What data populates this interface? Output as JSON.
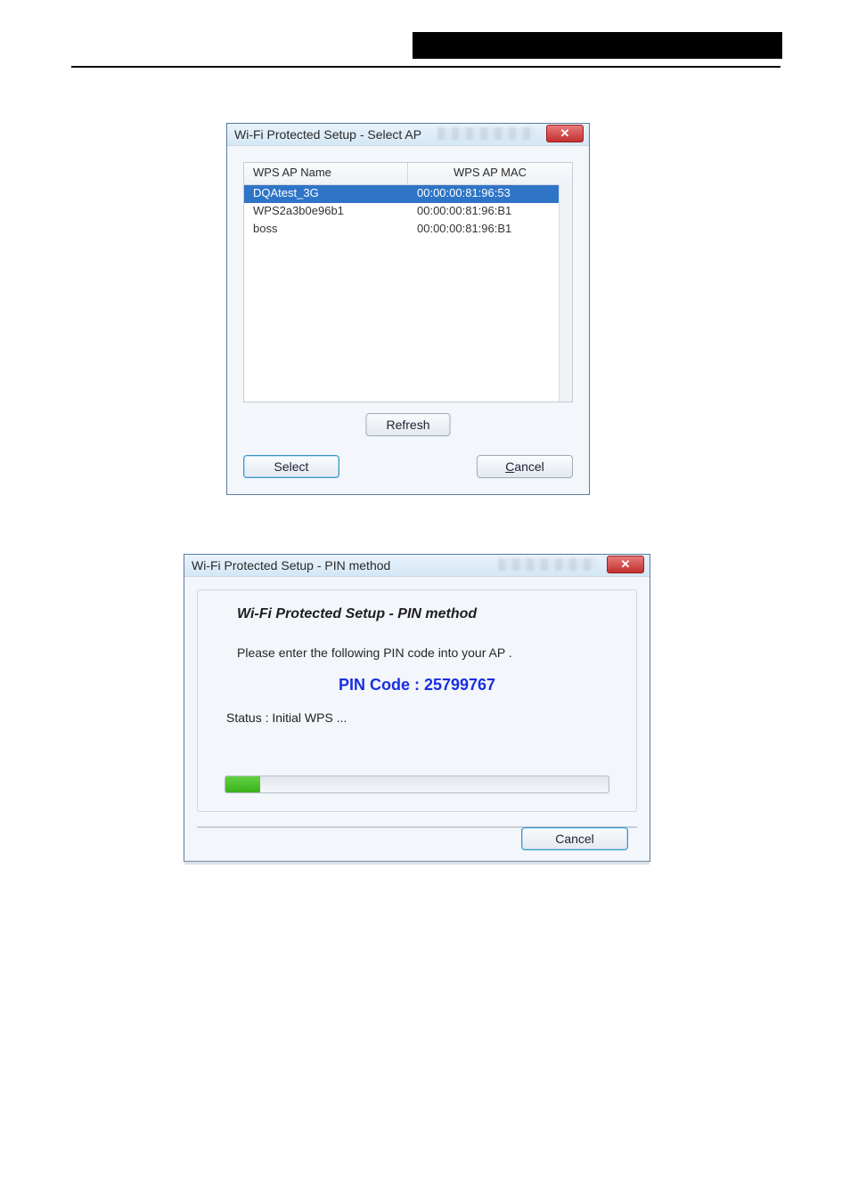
{
  "header": {
    "black_band": true
  },
  "window1": {
    "title": "Wi-Fi Protected Setup - Select AP",
    "columns": {
      "name": "WPS AP Name",
      "mac": "WPS AP MAC"
    },
    "rows": [
      {
        "name": "DQAtest_3G",
        "mac": "00:00:00:81:96:53",
        "selected": true
      },
      {
        "name": "WPS2a3b0e96b1",
        "mac": "00:00:00:81:96:B1",
        "selected": false
      },
      {
        "name": "boss",
        "mac": "00:00:00:81:96:B1",
        "selected": false
      }
    ],
    "buttons": {
      "refresh": "Refresh",
      "select": "Select",
      "cancel_letter": "C",
      "cancel_rest": "ancel"
    }
  },
  "window2": {
    "title": "Wi-Fi Protected Setup - PIN method",
    "heading": "Wi-Fi Protected Setup - PIN method",
    "instruction": "Please enter the following PIN code into your AP .",
    "pin_label": "PIN Code :  25799767",
    "status": "Status : Initial WPS ...",
    "progress_percent": 9,
    "cancel": "Cancel"
  }
}
